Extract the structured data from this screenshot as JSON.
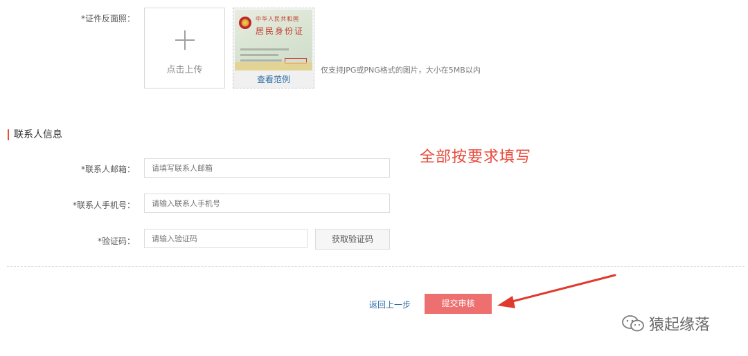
{
  "upload": {
    "label": "*证件反面照：",
    "upload_text": "点击上传",
    "sample_link": "查看范例",
    "hint": "仅支持JPG或PNG格式的图片，大小在5MB以内",
    "idcard_line1": "中华人民共和国",
    "idcard_line2": "居民身份证"
  },
  "contact_section": {
    "title": "联系人信息",
    "email": {
      "label": "*联系人邮箱：",
      "placeholder": "请填写联系人邮箱",
      "value": ""
    },
    "phone": {
      "label": "*联系人手机号：",
      "placeholder": "请输入联系人手机号",
      "value": ""
    },
    "code": {
      "label": "*验证码：",
      "placeholder": "请输入验证码",
      "value": "",
      "button": "获取验证码"
    }
  },
  "footer": {
    "back_label": "返回上一步",
    "submit_label": "提交审核"
  },
  "annotation": "全部按要求填写",
  "watermark": "猿起缘落",
  "colors": {
    "accent_red": "#ee6f6f",
    "link_blue": "#2f6ea5",
    "annotation_red": "#e84a3c"
  }
}
